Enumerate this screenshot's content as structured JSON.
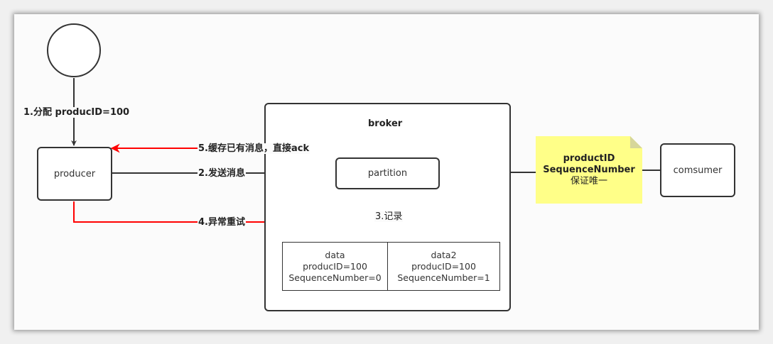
{
  "nodes": {
    "producer": "producer",
    "broker": "broker",
    "partition": "partition",
    "consumer": "comsumer",
    "data1": {
      "title": "data",
      "line1": "producID=100",
      "line2": "SequenceNumber=0"
    },
    "data2": {
      "title": "data2",
      "line1": "producID=100",
      "line2": "SequenceNumber=1"
    }
  },
  "edges": {
    "assign": "1.分配 producID=100",
    "send": "2.发送消息",
    "record": "3.记录",
    "retry": "4.异常重试",
    "cache_ack": "5.缓存已有消息，直接ack"
  },
  "note": {
    "line1": "productID",
    "line2": "SequenceNumber",
    "line3": "保证唯一"
  },
  "colors": {
    "error_path": "#ff0000",
    "stroke": "#333333",
    "note_fill": "#ffff88"
  }
}
